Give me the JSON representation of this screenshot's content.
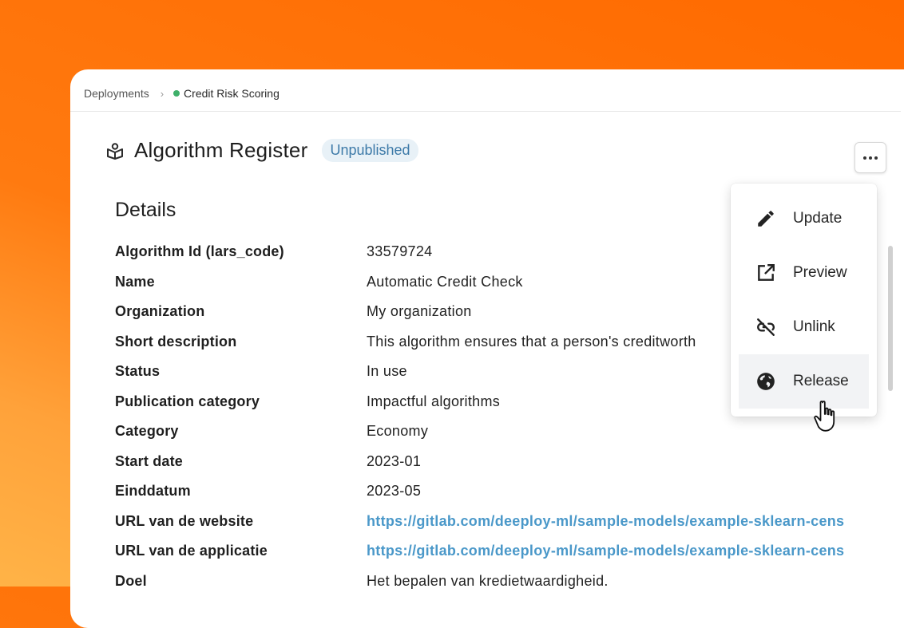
{
  "breadcrumb": {
    "parent": "Deployments",
    "current": "Credit Risk Scoring",
    "status_color": "#3fb06a"
  },
  "header": {
    "icon": "register-icon",
    "title": "Algorithm Register",
    "badge": "Unpublished"
  },
  "details": {
    "heading": "Details",
    "rows": [
      {
        "label": "Algorithm Id (lars_code)",
        "value": "33579724"
      },
      {
        "label": "Name",
        "value": "Automatic Credit Check"
      },
      {
        "label": "Organization",
        "value": "My organization"
      },
      {
        "label": "Short description",
        "value": "This algorithm ensures that a person's creditworth"
      },
      {
        "label": "Status",
        "value": "In use"
      },
      {
        "label": "Publication category",
        "value": "Impactful algorithms"
      },
      {
        "label": "Category",
        "value": "Economy"
      },
      {
        "label": "Start date",
        "value": "2023-01"
      },
      {
        "label": "Einddatum",
        "value": "2023-05"
      },
      {
        "label": "URL van de website",
        "value": "https://gitlab.com/deeploy-ml/sample-models/example-sklearn-cens",
        "link": true
      },
      {
        "label": "URL van de applicatie",
        "value": "https://gitlab.com/deeploy-ml/sample-models/example-sklearn-cens",
        "link": true
      },
      {
        "label": "Doel",
        "value": "Het bepalen van kredietwaardigheid."
      }
    ]
  },
  "menu": {
    "items": [
      {
        "label": "Update",
        "icon": "pencil-icon"
      },
      {
        "label": "Preview",
        "icon": "external-link-icon"
      },
      {
        "label": "Unlink",
        "icon": "unlink-icon"
      },
      {
        "label": "Release",
        "icon": "globe-icon",
        "active": true
      }
    ]
  },
  "colors": {
    "accent_link": "#4a98c9",
    "badge_bg": "#e8f1f7",
    "badge_text": "#3d7aa8",
    "background_orange": "#ff6a00"
  }
}
